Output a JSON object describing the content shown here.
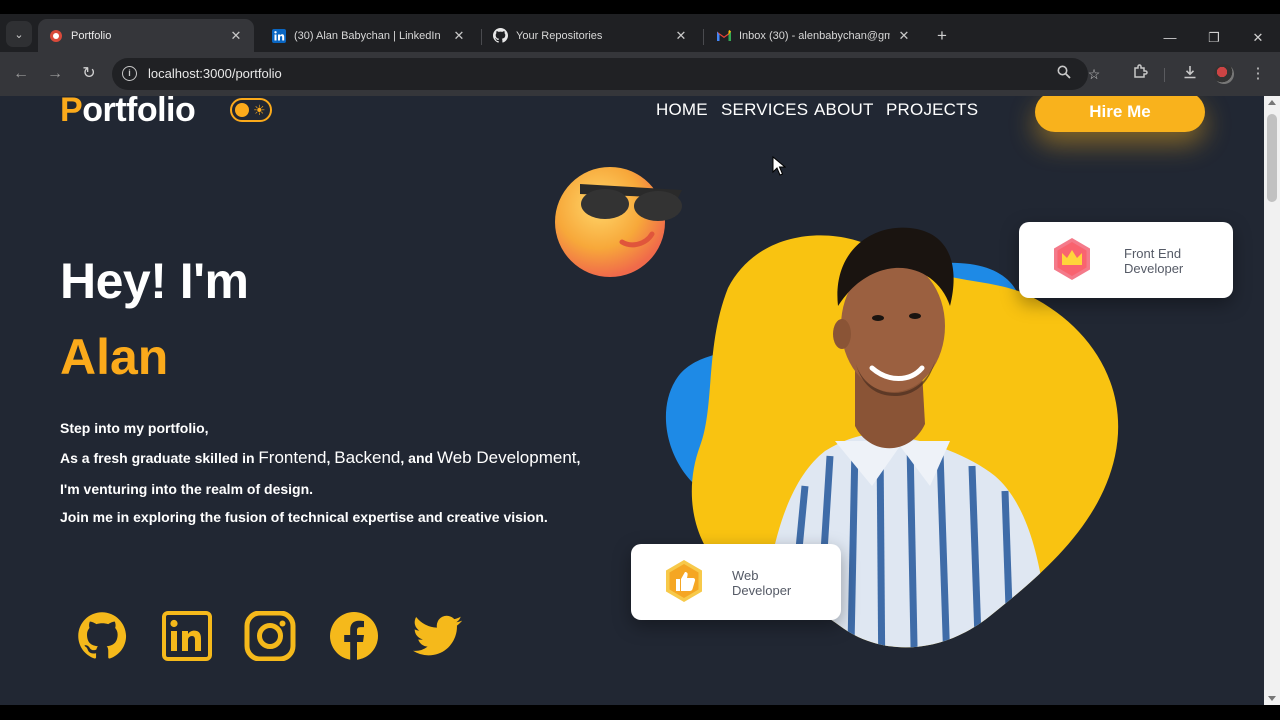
{
  "browser": {
    "tabs": [
      {
        "title": "Portfolio",
        "active": true
      },
      {
        "title": "(30) Alan Babychan | LinkedIn",
        "active": false
      },
      {
        "title": "Your Repositories",
        "active": false
      },
      {
        "title": "Inbox (30) - alenbabychan@gm",
        "active": false
      }
    ],
    "close_glyph": "✕",
    "new_tab_glyph": "+",
    "url": "localhost:3000/portfolio",
    "icons": [
      "back-icon",
      "forward-icon",
      "reload-icon",
      "site-info-icon",
      "zoom-icon",
      "bookmark-star-icon",
      "extensions-icon",
      "download-icon",
      "profile-avatar",
      "menu-kebab-icon"
    ]
  },
  "header": {
    "logo_first": "P",
    "logo_rest": "ortfolio",
    "nav": [
      "HOME",
      "SERVICES",
      "ABOUT",
      "PROJECTS"
    ],
    "hire_label": "Hire Me"
  },
  "hero": {
    "greeting": "Hey! I'm",
    "name": "Alan",
    "intro": "Step into my portfolio,",
    "line2_pre": "As a fresh graduate skilled in ",
    "skill1": "Frontend",
    "comma": ", ",
    "skill2": "Backend",
    "and": ", and ",
    "skill3": "Web Development",
    "line2_end": ",",
    "line3": "I'm venturing into the realm of design.",
    "line4": "Join me in exploring the fusion of technical expertise and creative vision."
  },
  "socials": [
    "github-icon",
    "linkedin-icon",
    "instagram-icon",
    "facebook-icon",
    "twitter-icon"
  ],
  "cards": {
    "frontend_line1": "Front End",
    "frontend_line2": "Developer",
    "web_line1": "Web",
    "web_line2": "Developer"
  },
  "colors": {
    "page_bg": "#212733",
    "accent": "#fbaa1b",
    "blob_yellow": "#f9c311",
    "blob_blue": "#1e8ae6"
  }
}
